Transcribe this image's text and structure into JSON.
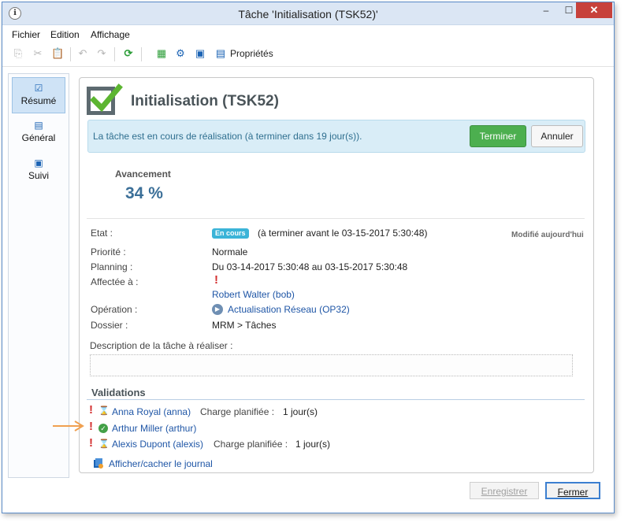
{
  "window": {
    "title": "Tâche 'Initialisation (TSK52)'",
    "minimize": "–",
    "maximize": "☐",
    "close": "✕"
  },
  "menu": [
    "Fichier",
    "Edition",
    "Affichage"
  ],
  "toolbar": {
    "properties_label": "Propriétés"
  },
  "sidebar": {
    "items": [
      {
        "label": "Résumé"
      },
      {
        "label": "Général"
      },
      {
        "label": "Suivi"
      }
    ]
  },
  "task": {
    "title": "Initialisation (TSK52)",
    "info_message": "La tâche est en cours de réalisation (à terminer dans 19 jour(s)).",
    "finish_button": "Terminer",
    "cancel_button": "Annuler",
    "progress_label": "Avancement",
    "progress_value": "34 %",
    "modified": "Modifié aujourd'hui",
    "fields": {
      "state_label": "Etat :",
      "state_badge": "En cours",
      "state_value": "(à terminer avant le 03-15-2017 5:30:48)",
      "priority_label": "Priorité :",
      "priority_value": "Normale",
      "planning_label": "Planning :",
      "planning_value": "Du 03-14-2017 5:30:48 au 03-15-2017 5:30:48",
      "assigned_label": "Affectée à :",
      "assigned_value": "Robert Walter (bob)",
      "operation_label": "Opération :",
      "operation_value": "Actualisation Réseau (OP32)",
      "folder_label": "Dossier :",
      "folder_value": "MRM > Tâches"
    },
    "description_label": "Description de la tâche à réaliser :",
    "description_value": ""
  },
  "validations": {
    "title": "Validations",
    "rows": [
      {
        "name": "Anna Royal (anna)",
        "charge_label": "Charge planifiée :",
        "charge_value": "1 jour(s)",
        "status": "pending"
      },
      {
        "name": "Arthur Miller (arthur)",
        "charge_label": "",
        "charge_value": "",
        "status": "approved"
      },
      {
        "name": "Alexis Dupont (alexis)",
        "charge_label": "Charge planifiée :",
        "charge_value": "1 jour(s)",
        "status": "pending"
      }
    ],
    "journal_link": "Afficher/cacher le journal"
  },
  "footer": {
    "save_button": "Enregistrer",
    "close_button": "Fermer"
  },
  "colors": {
    "accent": "#3c7fd0",
    "success": "#4caf4f",
    "info_bg": "#d9edf7",
    "link": "#1f56a6",
    "danger": "#d32f2f",
    "badge": "#3bb4d8"
  }
}
